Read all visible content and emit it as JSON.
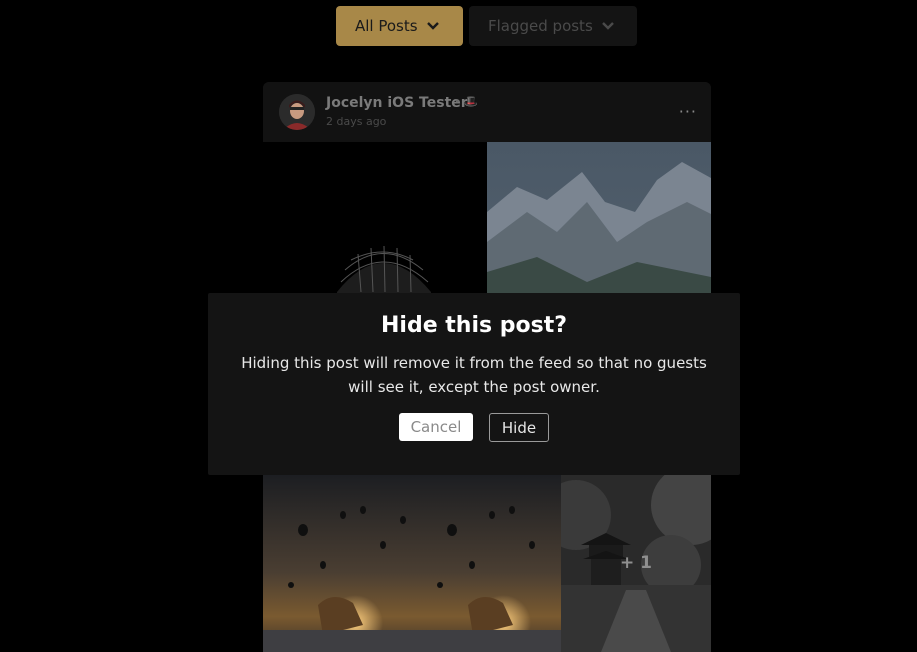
{
  "filters": {
    "all_posts": {
      "label": "All Posts",
      "icon": "chevron-down-icon"
    },
    "flagged_posts": {
      "label": "Flagged posts",
      "icon": "chevron-down-icon"
    }
  },
  "post": {
    "author": "Jocelyn iOS Tester",
    "badge": "• 🎩",
    "time": "2 days ago",
    "more_icon": "···",
    "extra_photos_label": "+ 1"
  },
  "modal": {
    "title": "Hide this post?",
    "text": "Hiding this post will remove it from the feed so that no guests will see it, except the post owner.",
    "cancel_label": "Cancel",
    "hide_label": "Hide"
  },
  "colors": {
    "accent": "#a88848",
    "background": "#000000",
    "modal_bg": "#141414"
  }
}
